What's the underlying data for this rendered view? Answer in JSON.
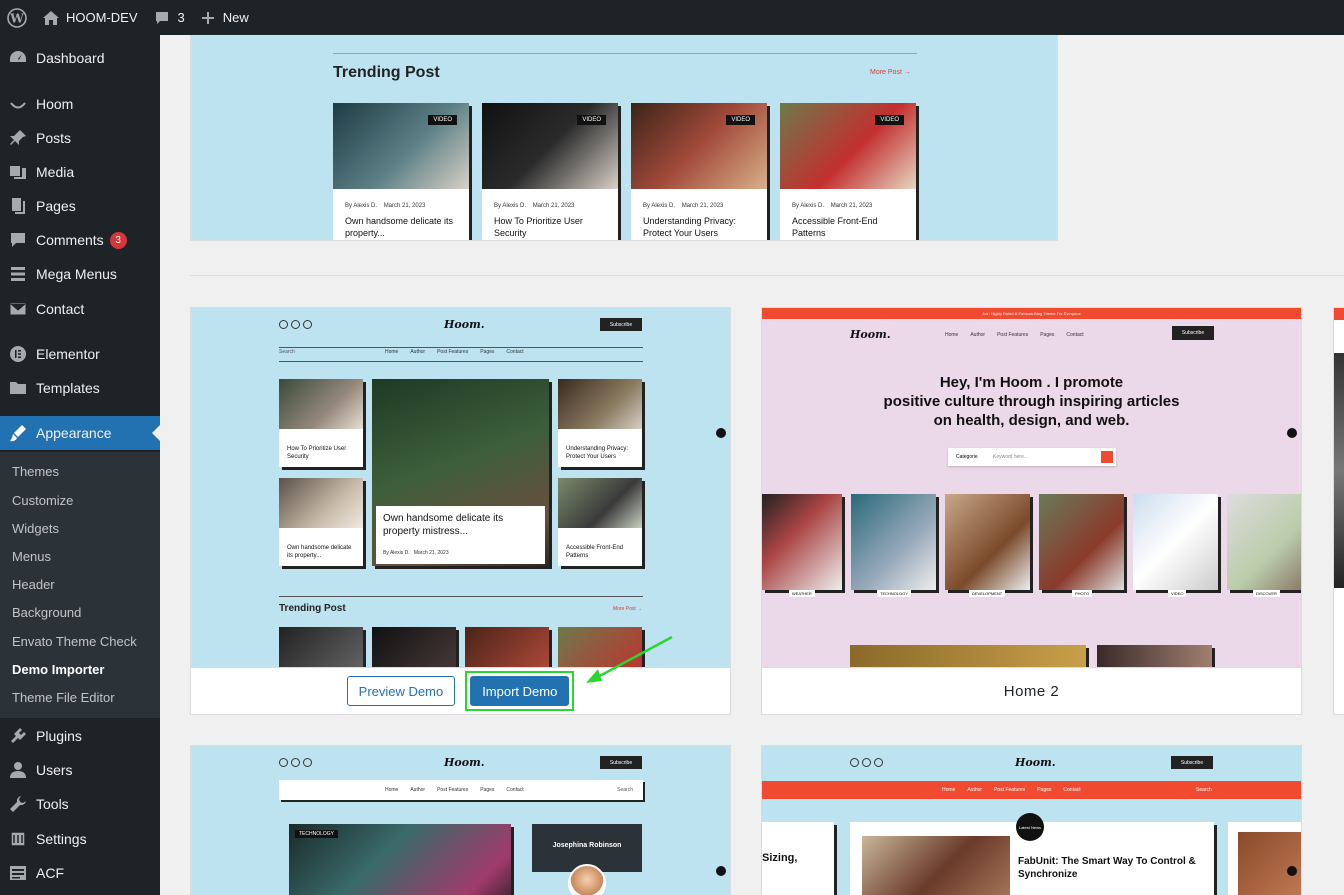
{
  "adminbar": {
    "site_name": "HOOM-DEV",
    "comments_count": "3",
    "new_label": "New"
  },
  "sidebar": {
    "items": [
      {
        "label": "Dashboard",
        "icon": "dashboard-icon"
      },
      {
        "label": "Hoom",
        "icon": "smile-icon"
      },
      {
        "label": "Posts",
        "icon": "pin-icon"
      },
      {
        "label": "Media",
        "icon": "media-icon"
      },
      {
        "label": "Pages",
        "icon": "pages-icon"
      },
      {
        "label": "Comments",
        "icon": "comment-icon",
        "badge": "3"
      },
      {
        "label": "Mega Menus",
        "icon": "menu-icon"
      },
      {
        "label": "Contact",
        "icon": "mail-icon"
      },
      {
        "label": "Elementor",
        "icon": "elementor-icon"
      },
      {
        "label": "Templates",
        "icon": "folder-icon"
      },
      {
        "label": "Appearance",
        "icon": "brush-icon"
      },
      {
        "label": "Plugins",
        "icon": "plugin-icon"
      },
      {
        "label": "Users",
        "icon": "user-icon"
      },
      {
        "label": "Tools",
        "icon": "wrench-icon"
      },
      {
        "label": "Settings",
        "icon": "settings-icon"
      },
      {
        "label": "ACF",
        "icon": "acf-icon"
      }
    ],
    "submenu": [
      "Themes",
      "Customize",
      "Widgets",
      "Menus",
      "Header",
      "Background",
      "Envato Theme Check",
      "Demo Importer",
      "Theme File Editor"
    ]
  },
  "top_preview": {
    "section_title": "Trending Post",
    "more_link": "More Post →",
    "posts": [
      {
        "tag": "VIDEO",
        "author": "By Alexis D.",
        "date": "March 21, 2023",
        "title": "Own handsome delicate its property..."
      },
      {
        "tag": "VIDEO",
        "author": "By Alexis D.",
        "date": "March 21, 2023",
        "title": "How To Prioritize User Security"
      },
      {
        "tag": "VIDEO",
        "author": "By Alexis D.",
        "date": "March 21, 2023",
        "title": "Understanding Privacy: Protect Your Users"
      },
      {
        "tag": "VIDEO",
        "author": "By Alexis D.",
        "date": "March 21, 2023",
        "title": "Accessible Front-End Patterns"
      }
    ]
  },
  "demo1": {
    "logo": "Hoom.",
    "subscribe": "Subscribe",
    "search": "Search",
    "nav": [
      "Home",
      "Author",
      "Post Features",
      "Pages",
      "Contact"
    ],
    "featured_title": "Own handsome delicate its property mistress...",
    "featured_author": "By Alexis D.",
    "featured_date": "March 21, 2023",
    "left_top_title": "How To Prioritize User Security",
    "left_bottom_title": "Own handsome delicate its property...",
    "right_top_title": "Understanding Privacy: Protect Your Users",
    "right_bottom_title": "Accessible Front-End Patterns",
    "trending": "Trending Post",
    "more": "More Post →",
    "preview_button": "Preview Demo",
    "import_button": "Import Demo"
  },
  "demo2": {
    "topbar": "Join Highly Rated & Famous Blog Theme For Everyone",
    "logo": "Hoom.",
    "subscribe": "Subscribe",
    "nav": [
      "Home",
      "Author",
      "Post Features",
      "Pages",
      "Contact"
    ],
    "hero_line1": "Hey, I'm Hoom . I promote",
    "hero_line2": "positive culture through inspiring articles",
    "hero_line3": "on health, design, and web.",
    "search_category": "Categorie",
    "search_placeholder": "Keyword here...",
    "categories": [
      "WEATHER",
      "TECHNOLOGY",
      "DEVELOPMENT",
      "PHOTO",
      "VIDEO",
      "DISCOVER"
    ],
    "name": "Home 2"
  },
  "demo3": {
    "logo": "Hoom.",
    "subscribe": "Subscribe",
    "nav": [
      "Home",
      "Author",
      "Post Features",
      "Pages",
      "Contact"
    ],
    "search": "Search",
    "tag": "TECHNOLOGY",
    "author_name": "Josephina Robinson"
  },
  "demo4": {
    "logo": "Hoom.",
    "subscribe": "Subscribe",
    "nav": [
      "Home",
      "Author",
      "Post Features",
      "Pages",
      "Contact"
    ],
    "search": "Search",
    "latest_badge": "Latest News",
    "left_text": "Sizing,",
    "article_title": "FabUnit: The Smart Way To Control & Synchronize"
  }
}
